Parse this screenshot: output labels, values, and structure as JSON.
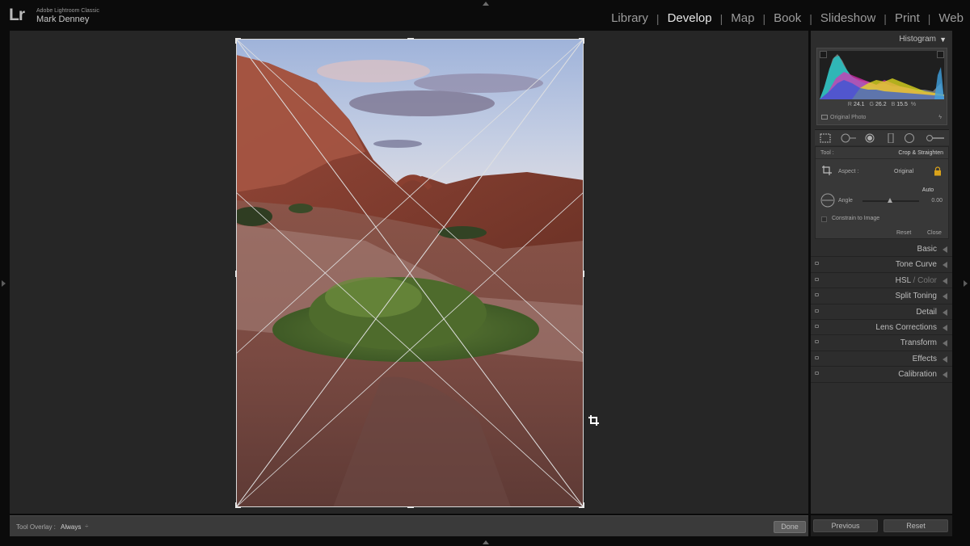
{
  "app": {
    "logo": "Lr",
    "product_name": "Adobe Lightroom Classic",
    "user_name": "Mark Denney"
  },
  "modules": [
    {
      "label": "Library",
      "active": false
    },
    {
      "label": "Develop",
      "active": true
    },
    {
      "label": "Map",
      "active": false
    },
    {
      "label": "Book",
      "active": false
    },
    {
      "label": "Slideshow",
      "active": false
    },
    {
      "label": "Print",
      "active": false
    },
    {
      "label": "Web",
      "active": false
    }
  ],
  "histogram": {
    "title": "Histogram",
    "r_label": "R",
    "r_value": "24.1",
    "g_label": "G",
    "g_value": "26.2",
    "b_label": "B",
    "b_value": "15.5",
    "b_unit": "%",
    "original_photo": "Original Photo"
  },
  "crop": {
    "tool_label": "Tool :",
    "tool_name": "Crop & Straighten",
    "aspect_label": "Aspect :",
    "aspect_value": "Original",
    "auto_label": "Auto",
    "angle_label": "Angle",
    "angle_value": "0.00",
    "constrain_label": "Constrain to Image",
    "reset_label": "Reset",
    "close_label": "Close"
  },
  "panels": [
    {
      "title": "Basic",
      "has_switch": false
    },
    {
      "title": "Tone Curve",
      "has_switch": true
    },
    {
      "title": "HSL",
      "suffix": " / Color",
      "has_switch": true
    },
    {
      "title": "Split Toning",
      "has_switch": true
    },
    {
      "title": "Detail",
      "has_switch": true
    },
    {
      "title": "Lens Corrections",
      "has_switch": true
    },
    {
      "title": "Transform",
      "has_switch": true
    },
    {
      "title": "Effects",
      "has_switch": true
    },
    {
      "title": "Calibration",
      "has_switch": true
    }
  ],
  "toolbar": {
    "overlay_label": "Tool Overlay :",
    "overlay_value": "Always",
    "done_label": "Done"
  },
  "bottom_buttons": {
    "previous_label": "Previous",
    "reset_label": "Reset"
  },
  "icons": {
    "crop_overlay": "crop-tool-icon",
    "spot_removal": "spot-removal-icon",
    "red_eye": "red-eye-icon",
    "graduated_filter": "graduated-filter-icon",
    "radial_filter": "radial-filter-icon",
    "adjustment_brush": "adjustment-brush-icon"
  },
  "colors": {
    "background": "#0b0b0b",
    "canvas": "#262626",
    "panel": "#2d2d2d",
    "accent_lock": "#d9a21b"
  }
}
